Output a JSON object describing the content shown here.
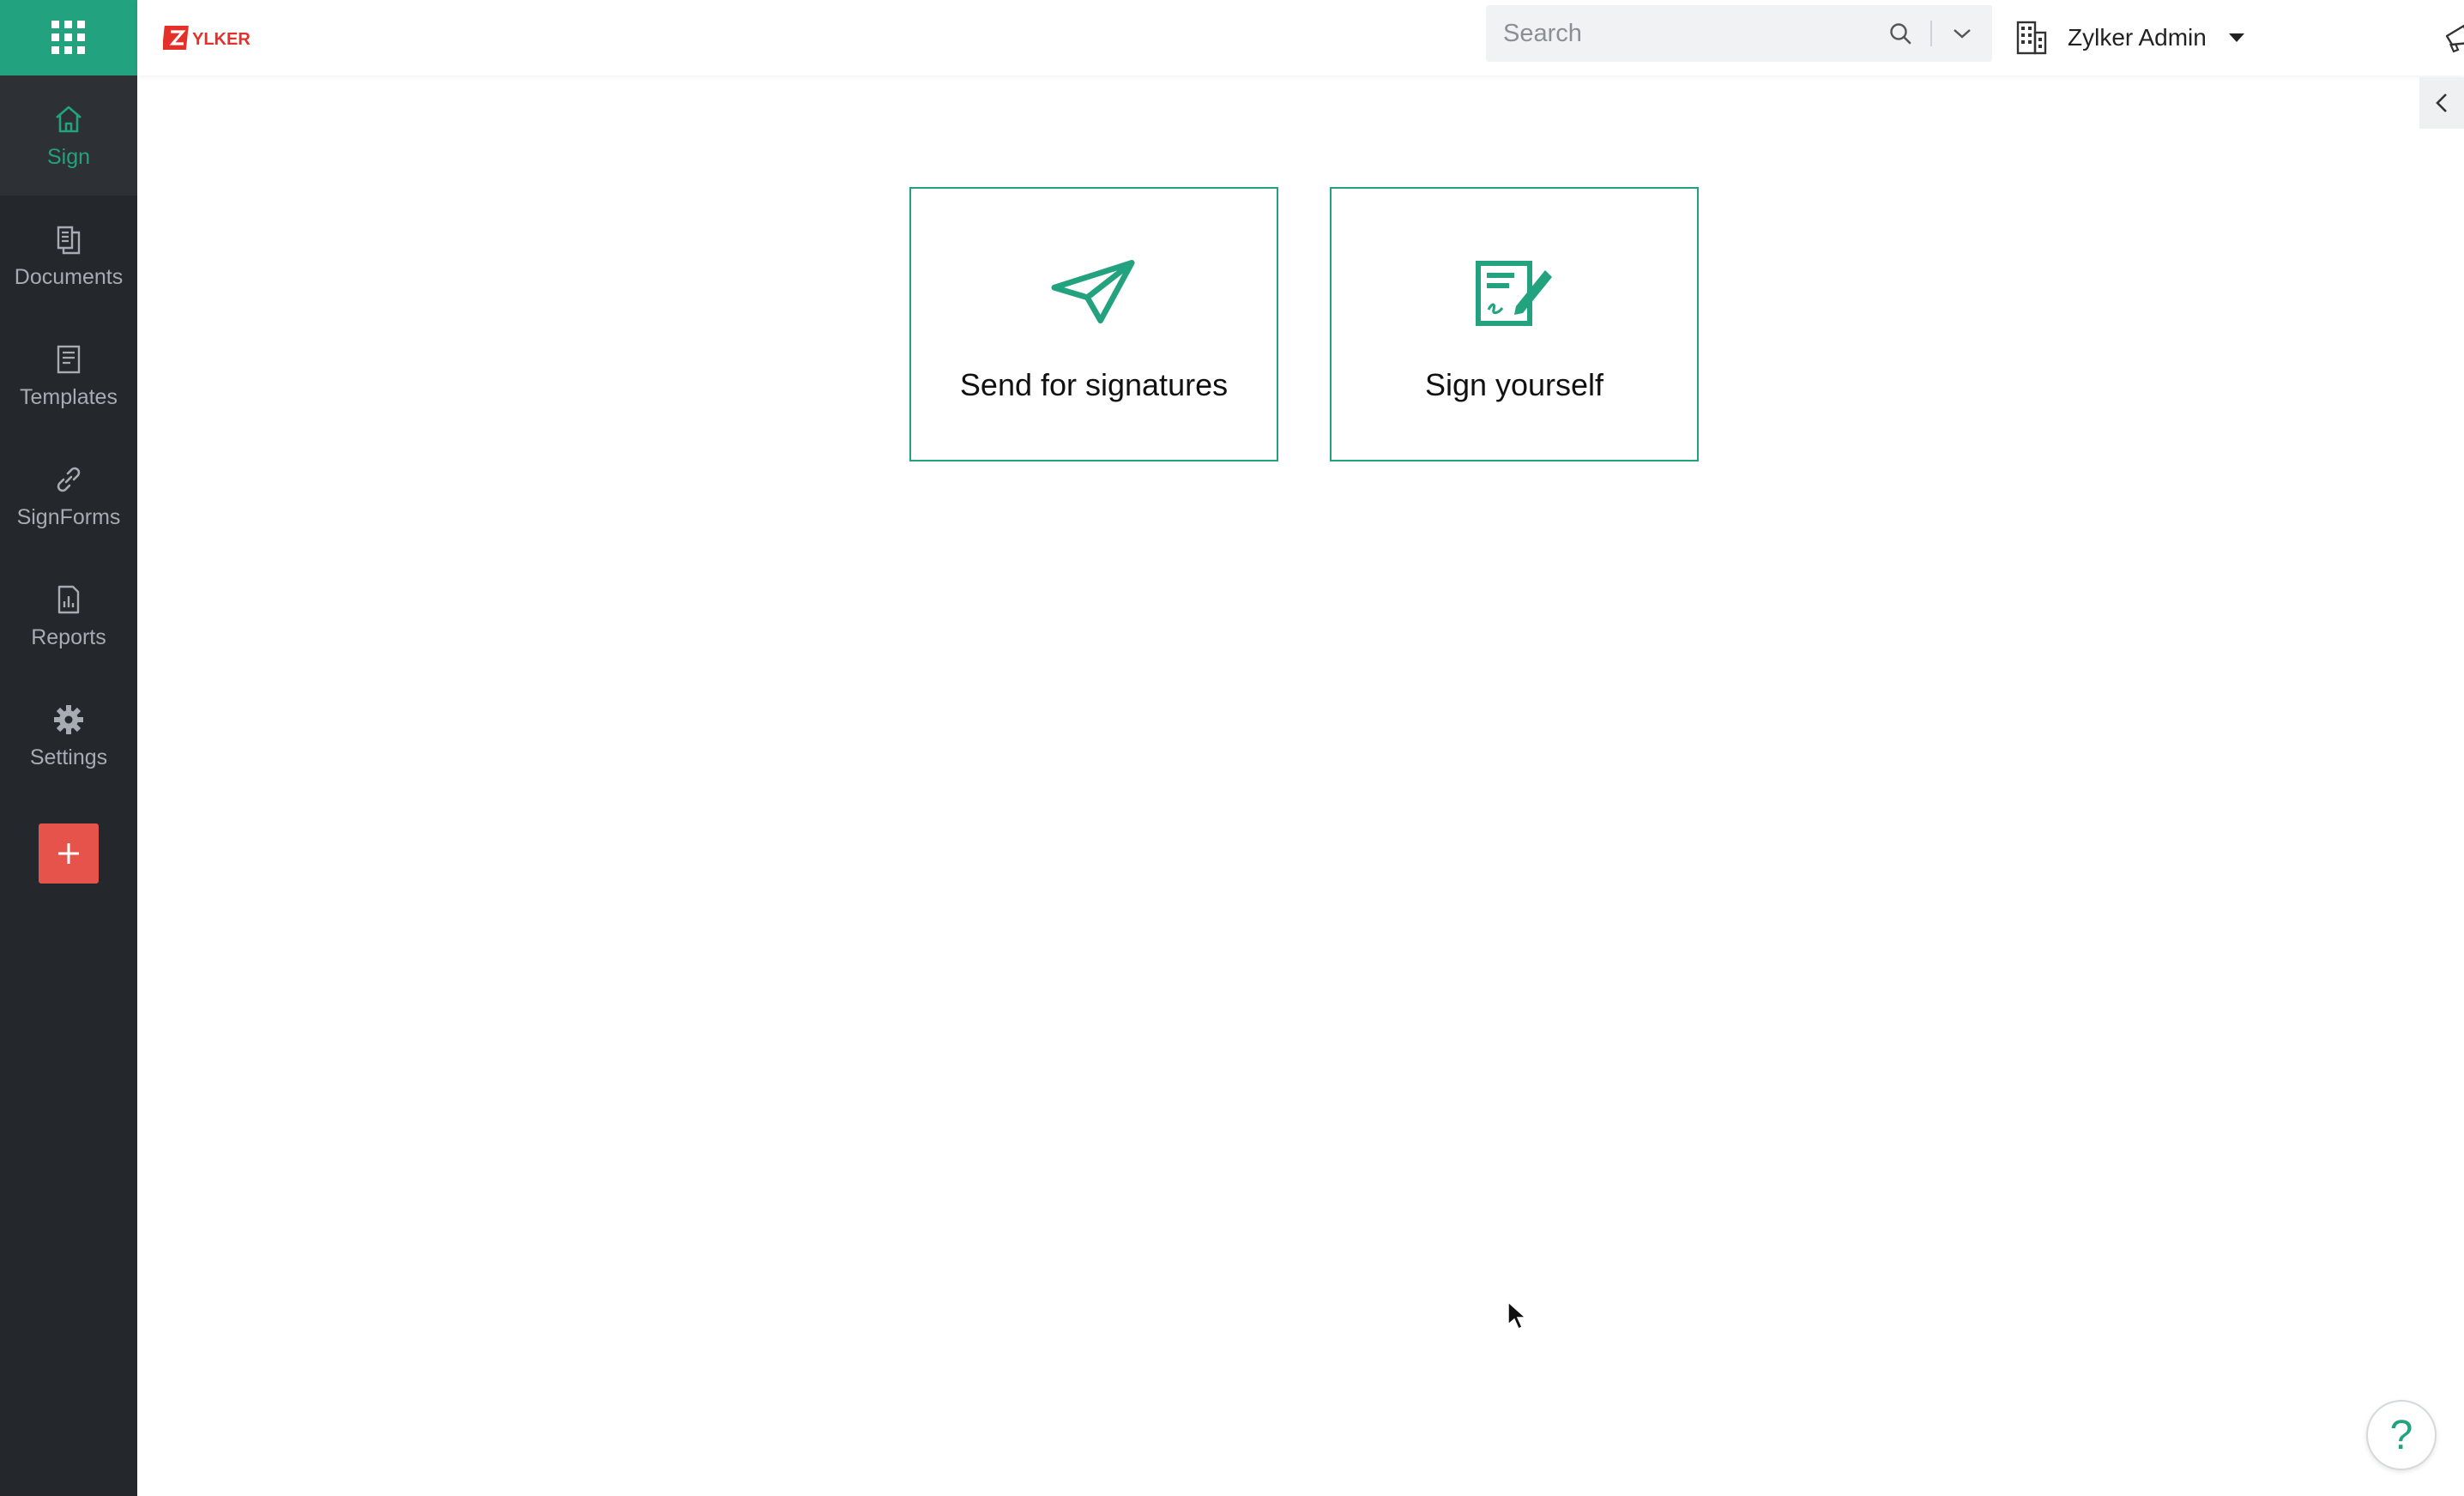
{
  "app": {
    "brand_logo_text": "ZYLKER",
    "accent_color": "#22a27e",
    "sidebar_bg": "#24272c",
    "add_button_color": "#e5534b"
  },
  "sidebar": {
    "items": [
      {
        "label": "Sign",
        "icon": "home-icon",
        "active": true
      },
      {
        "label": "Documents",
        "icon": "documents-icon"
      },
      {
        "label": "Templates",
        "icon": "templates-icon"
      },
      {
        "label": "SignForms",
        "icon": "link-icon"
      },
      {
        "label": "Reports",
        "icon": "reports-icon"
      },
      {
        "label": "Settings",
        "icon": "gear-icon"
      }
    ],
    "add_label": "+"
  },
  "topbar": {
    "search_placeholder": "Search",
    "org_name": "Zylker Admin"
  },
  "cards": [
    {
      "label": "Send for signatures",
      "icon": "paper-plane-icon"
    },
    {
      "label": "Sign yourself",
      "icon": "sign-document-icon"
    }
  ],
  "help": {
    "label": "?"
  }
}
